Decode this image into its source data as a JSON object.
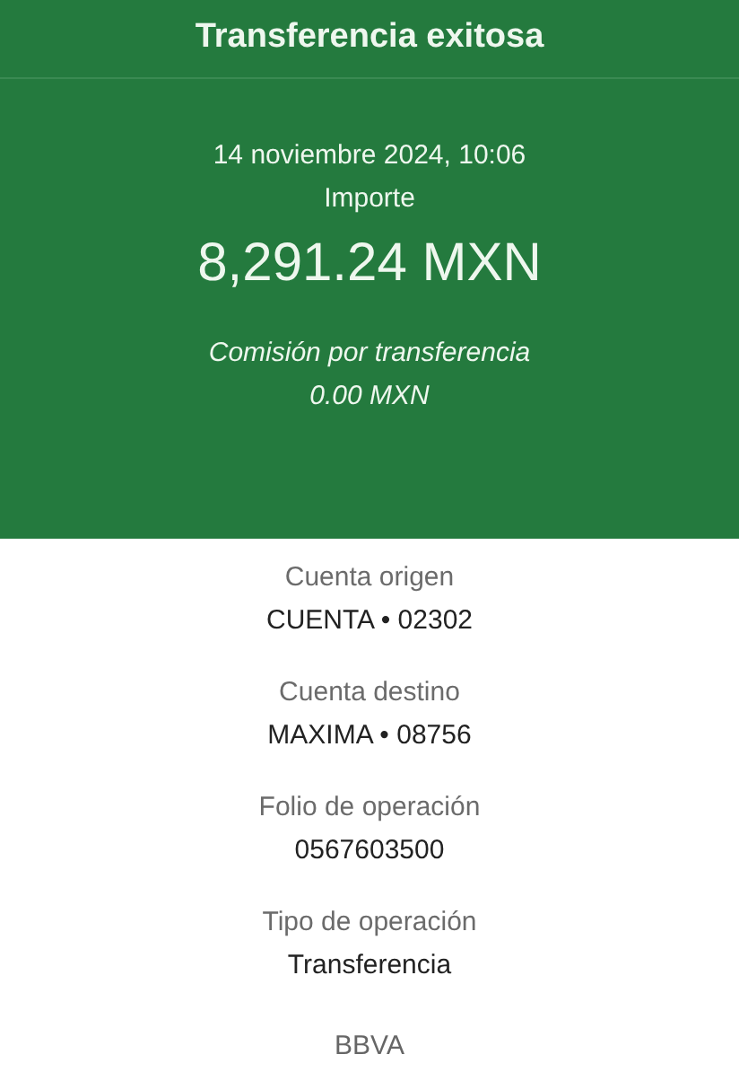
{
  "header": {
    "title": "Transferencia exitosa"
  },
  "summary": {
    "date": "14 noviembre 2024, 10:06",
    "amount_label": "Importe",
    "amount": "8,291.24 MXN",
    "fee_label": "Comisión por transferencia",
    "fee": "0.00 MXN"
  },
  "details": [
    {
      "label": "Cuenta origen",
      "value": "CUENTA • 02302"
    },
    {
      "label": "Cuenta destino",
      "value": "MAXIMA • 08756"
    },
    {
      "label": "Folio de operación",
      "value": "0567603500"
    },
    {
      "label": "Tipo de operación",
      "value": "Transferencia"
    }
  ],
  "footer": "BBVA"
}
